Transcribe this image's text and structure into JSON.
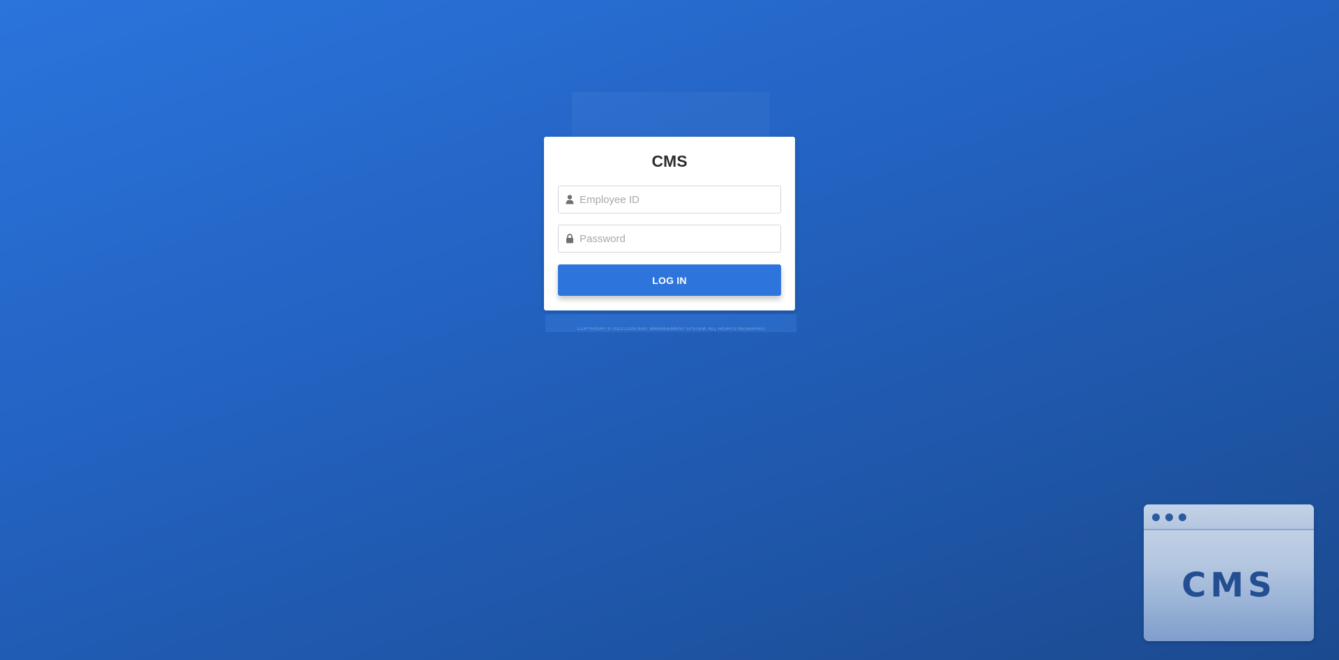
{
  "login": {
    "title": "CMS",
    "employee_id_placeholder": "Employee ID",
    "password_placeholder": "Password",
    "login_button_label": "LOG IN",
    "user_icon": "user-icon",
    "lock_icon": "lock-icon"
  },
  "footer": {
    "text": "COPYRIGHT © 2023 CONTENT MANAGEMENT SYSTEM. ALL RIGHTS RESERVED."
  },
  "widget": {
    "label": "CMS"
  },
  "colors": {
    "accent": "#2d74dd",
    "background_start": "#2b74dc",
    "background_end": "#1b4a8f",
    "widget_text": "#234f92"
  }
}
